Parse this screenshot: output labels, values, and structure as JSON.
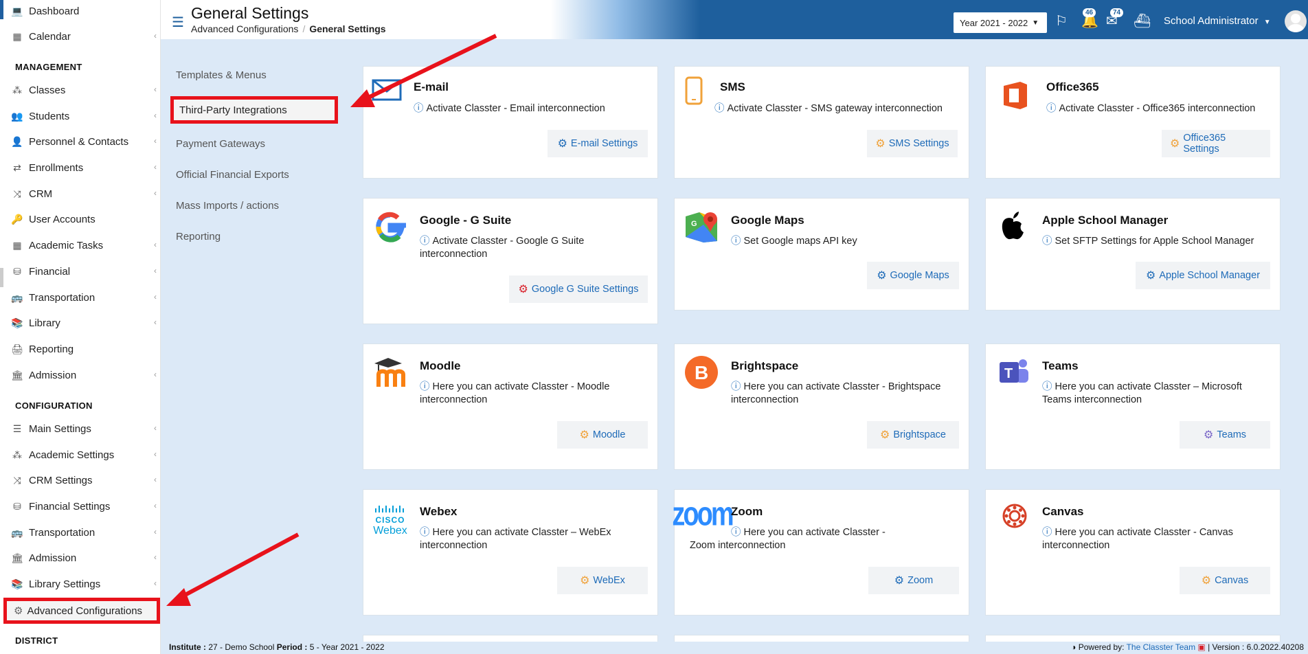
{
  "sidebar": {
    "top_items": [
      {
        "label": "Dashboard",
        "icon": "laptop-icon"
      },
      {
        "label": "Calendar",
        "icon": "calendar-icon"
      }
    ],
    "management_heading": "MANAGEMENT",
    "management_items": [
      {
        "label": "Classes",
        "icon": "people-icon"
      },
      {
        "label": "Students",
        "icon": "users-icon"
      },
      {
        "label": "Personnel & Contacts",
        "icon": "person-icon"
      },
      {
        "label": "Enrollments",
        "icon": "exchange-icon"
      },
      {
        "label": "CRM",
        "icon": "shuffle-icon"
      },
      {
        "label": "User Accounts",
        "icon": "key-icon"
      },
      {
        "label": "Academic Tasks",
        "icon": "grid-icon"
      },
      {
        "label": "Financial",
        "icon": "coins-icon"
      },
      {
        "label": "Transportation",
        "icon": "bus-icon"
      },
      {
        "label": "Library",
        "icon": "books-icon"
      },
      {
        "label": "Reporting",
        "icon": "printer-icon"
      },
      {
        "label": "Admission",
        "icon": "building-icon"
      }
    ],
    "configuration_heading": "CONFIGURATION",
    "configuration_items": [
      {
        "label": "Main Settings",
        "icon": "sliders-icon"
      },
      {
        "label": "Academic Settings",
        "icon": "people-icon"
      },
      {
        "label": "CRM Settings",
        "icon": "shuffle-icon"
      },
      {
        "label": "Financial Settings",
        "icon": "coins-icon"
      },
      {
        "label": "Transportation",
        "icon": "bus-icon"
      },
      {
        "label": "Admission",
        "icon": "building-icon"
      },
      {
        "label": "Library Settings",
        "icon": "books-icon"
      }
    ],
    "advanced_configurations": "Advanced Configurations",
    "district_heading": "DISTRICT"
  },
  "header": {
    "title": "General Settings",
    "breadcrumb_parent": "Advanced Configurations",
    "breadcrumb_current": "General Settings",
    "year": "Year 2021 - 2022",
    "badge_notifications": "46",
    "badge_messages": "74",
    "user": "School Administrator"
  },
  "settings_menu": {
    "items": [
      "Templates & Menus",
      "Third-Party Integrations",
      "Payment Gateways",
      "Official Financial Exports",
      "Mass Imports / actions",
      "Reporting"
    ],
    "active": "Third-Party Integrations"
  },
  "cards": [
    {
      "title": "E-mail",
      "desc": "Activate Classter - Email interconnection",
      "button": "E-mail Settings",
      "btn_color": "#1e6bb8",
      "gear_color": "#1e6bb8"
    },
    {
      "title": "SMS",
      "desc": "Activate Classter - SMS gateway interconnection",
      "button": "SMS Settings",
      "btn_color": "#1e6bb8",
      "gear_color": "#f0a23a"
    },
    {
      "title": "Office365",
      "desc": "Activate Classter - Office365 interconnection",
      "button": "Office365 Settings",
      "btn_color": "#1e6bb8",
      "gear_color": "#f0a23a"
    },
    {
      "title": "Google - G Suite",
      "desc": "Activate Classter - Google G Suite interconnection",
      "button": "Google G Suite Settings",
      "btn_color": "#1e6bb8",
      "gear_color": "#d8202a"
    },
    {
      "title": "Google Maps",
      "desc": "Set Google maps API key",
      "button": "Google Maps",
      "btn_color": "#1e6bb8",
      "gear_color": "#1e6bb8"
    },
    {
      "title": "Apple School Manager",
      "desc": "Set SFTP Settings for Apple School Manager",
      "button": "Apple School Manager",
      "btn_color": "#1e6bb8",
      "gear_color": "#1e6bb8"
    },
    {
      "title": "Moodle",
      "desc": "Here you can activate Classter - Moodle interconnection",
      "button": "Moodle",
      "btn_color": "#1e6bb8",
      "gear_color": "#f0a23a"
    },
    {
      "title": "Brightspace",
      "desc": "Here you can activate Classter - Brightspace interconnection",
      "button": "Brightspace",
      "btn_color": "#1e6bb8",
      "gear_color": "#f0a23a"
    },
    {
      "title": "Teams",
      "desc": "Here you can activate Classter – Microsoft Teams interconnection",
      "button": "Teams",
      "btn_color": "#1e6bb8",
      "gear_color": "#7b68c8"
    },
    {
      "title": "Webex",
      "desc": "Here you can activate Classter – WebEx interconnection",
      "button": "WebEx",
      "btn_color": "#1e6bb8",
      "gear_color": "#f0a23a"
    },
    {
      "title": "Zoom",
      "desc": "Here you can activate Classter - Zoom interconnection",
      "button": "Zoom",
      "btn_color": "#1e6bb8",
      "gear_color": "#1e6bb8"
    },
    {
      "title": "Canvas",
      "desc": "Here you can activate Classter - Canvas interconnection",
      "button": "Canvas",
      "btn_color": "#1e6bb8",
      "gear_color": "#f0a23a"
    }
  ],
  "logo_text": {
    "cisco": "CISCO",
    "webex": "Webex",
    "zoom": "zoom"
  },
  "footer": {
    "institute_label": "Institute :",
    "institute_value": "27 - Demo School",
    "period_label": "Period :",
    "period_value": "5 - Year 2021 - 2022",
    "powered_label": "Powered by:",
    "powered_link": "The Classter Team",
    "version": "| Version : 6.0.2022.40208"
  },
  "colors": {
    "header_blue": "#1e5f9d",
    "annotation_red": "#e8121b",
    "link_blue": "#1e6bb8"
  }
}
